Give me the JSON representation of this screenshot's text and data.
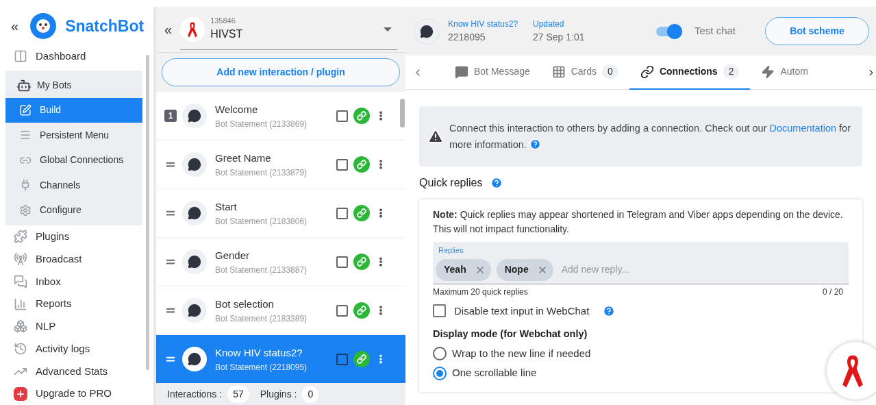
{
  "brand": {
    "name": "SnatchBot",
    "collapse": "«"
  },
  "sidebar": {
    "items": [
      {
        "label": "Dashboard",
        "selected": false
      },
      {
        "label": "My Bots",
        "selected": false,
        "children": [
          {
            "label": "Build",
            "selected": true
          },
          {
            "label": "Persistent Menu",
            "selected": false
          },
          {
            "label": "Global Connections",
            "selected": false
          },
          {
            "label": "Channels",
            "selected": false
          },
          {
            "label": "Configure",
            "selected": false
          }
        ]
      },
      {
        "label": "Plugins",
        "selected": false
      },
      {
        "label": "Broadcast",
        "selected": false
      },
      {
        "label": "Inbox",
        "selected": false
      },
      {
        "label": "Reports",
        "selected": false
      },
      {
        "label": "NLP",
        "selected": false
      },
      {
        "label": "Activity logs",
        "selected": false
      },
      {
        "label": "Advanced Stats",
        "selected": false
      },
      {
        "label": "Upgrade to PRO",
        "selected": false
      }
    ]
  },
  "bot": {
    "collapse": "«",
    "id": "135846",
    "name": "HIVST"
  },
  "add_button": "Add new interaction / plugin",
  "interactions": [
    {
      "badge": "1",
      "name": "Welcome",
      "sub": "Bot Statement (2133869)",
      "checked": false,
      "selected": false
    },
    {
      "name": "Greet Name",
      "sub": "Bot Statement (2133879)",
      "checked": false,
      "selected": false
    },
    {
      "name": "Start",
      "sub": "Bot Statement (2183806)",
      "checked": false,
      "selected": false
    },
    {
      "name": "Gender",
      "sub": "Bot Statement (2133887)",
      "checked": false,
      "selected": false
    },
    {
      "name": "Bot selection",
      "sub": "Bot Statement (2183389)",
      "checked": false,
      "selected": false
    },
    {
      "name": "Know HIV status2?",
      "sub": "Bot Statement (2218095)",
      "checked": false,
      "selected": true
    }
  ],
  "counts": [
    {
      "label": "Interactions :",
      "value": "57"
    },
    {
      "label": "Plugins :",
      "value": "0"
    }
  ],
  "header": {
    "title": "Know HIV status2?",
    "id": "2218095",
    "updated_label": "Updated",
    "updated": "27 Sep 1:01",
    "test_chat": {
      "label": "Test chat",
      "on": true
    },
    "scheme_button": "Bot scheme"
  },
  "tabs": [
    {
      "label": "Bot Message",
      "selected": false
    },
    {
      "label": "Cards",
      "count": "0",
      "selected": false
    },
    {
      "label": "Connections",
      "count": "2",
      "selected": true
    },
    {
      "label": "Autom",
      "selected": false
    }
  ],
  "info": {
    "text": "Connect this interaction to others by adding a connection. Check out our",
    "link": "Documentation",
    "after": "for more information."
  },
  "quick_replies": {
    "title": "Quick replies",
    "note": "**Note:** Quick replies may appear shortened in Telegram and Viber apps depending on the device. This will not impact functionality.",
    "field_label": "Replies",
    "chips": [
      "Yeah",
      "Nope"
    ],
    "placeholder": "Add new reply...",
    "helper": "Maximum 20 quick replies",
    "counter": "0 / 20"
  },
  "disable_input": {
    "label": "Disable text input in WebChat",
    "checked": false
  },
  "display_mode": {
    "title": "Display mode (for Webchat only)",
    "options": [
      {
        "label": "Wrap to the new line if needed",
        "selected": false
      },
      {
        "label": "One scrollable line",
        "selected": true
      }
    ]
  }
}
